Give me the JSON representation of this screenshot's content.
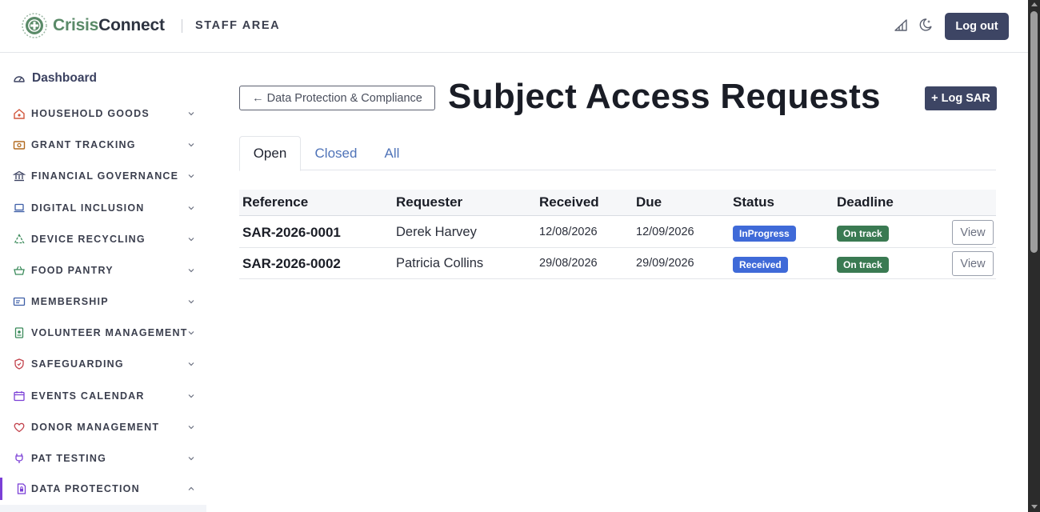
{
  "header": {
    "brand_prefix": "Crisis",
    "brand_suffix": "Connect",
    "area_label": "STAFF AREA",
    "logout_label": "Log out",
    "icons": [
      "chart-icon",
      "dark-mode-icon"
    ]
  },
  "sidebar": {
    "dashboard_label": "Dashboard",
    "items": [
      {
        "label": "HOUSEHOLD GOODS",
        "icon": "house-icon",
        "expanded": false
      },
      {
        "label": "GRANT TRACKING",
        "icon": "money-icon",
        "expanded": false
      },
      {
        "label": "FINANCIAL GOVERNANCE",
        "icon": "bank-icon",
        "expanded": false
      },
      {
        "label": "DIGITAL INCLUSION",
        "icon": "laptop-icon",
        "expanded": false
      },
      {
        "label": "DEVICE RECYCLING",
        "icon": "recycle-icon",
        "expanded": false
      },
      {
        "label": "FOOD PANTRY",
        "icon": "basket-icon",
        "expanded": false
      },
      {
        "label": "MEMBERSHIP",
        "icon": "id-card-icon",
        "expanded": false
      },
      {
        "label": "VOLUNTEER MANAGEMENT",
        "icon": "badge-icon",
        "expanded": false
      },
      {
        "label": "SAFEGUARDING",
        "icon": "shield-icon",
        "expanded": false
      },
      {
        "label": "EVENTS CALENDAR",
        "icon": "calendar-icon",
        "expanded": false
      },
      {
        "label": "DONOR MANAGEMENT",
        "icon": "heart-icon",
        "expanded": false
      },
      {
        "label": "PAT TESTING",
        "icon": "plug-icon",
        "expanded": false
      },
      {
        "label": "DATA PROTECTION",
        "icon": "lock-file-icon",
        "expanded": true
      }
    ]
  },
  "main": {
    "back_label": "← Data Protection & Compliance",
    "title": "Subject Access Requests",
    "log_button": "+ Log SAR",
    "tabs": [
      {
        "label": "Open",
        "active": true
      },
      {
        "label": "Closed",
        "active": false
      },
      {
        "label": "All",
        "active": false
      }
    ],
    "table": {
      "headers": [
        "Reference",
        "Requester",
        "Received",
        "Due",
        "Status",
        "Deadline"
      ],
      "rows": [
        {
          "reference": "SAR-2026-0001",
          "requester": "Derek Harvey",
          "received": "12/08/2026",
          "due": "12/09/2026",
          "status": "InProgress",
          "deadline": "On track",
          "action": "View"
        },
        {
          "reference": "SAR-2026-0002",
          "requester": "Patricia Collins",
          "received": "29/08/2026",
          "due": "29/09/2026",
          "status": "Received",
          "deadline": "On track",
          "action": "View"
        }
      ]
    }
  },
  "colors": {
    "primary": "#3d4564",
    "status_blue": "#3f6ad8",
    "deadline_green": "#3a7a52",
    "active_accent": "#7b3fd6",
    "brand_green": "#5a8a68"
  }
}
